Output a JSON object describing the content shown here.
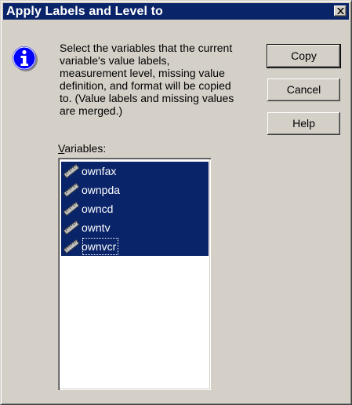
{
  "window": {
    "title": "Apply Labels and Level to"
  },
  "icons": {
    "info": "info-icon",
    "close": "close-icon",
    "variable": "ruler-icon"
  },
  "message": "Select the variables that the current\nvariable's value labels,\nmeasurement level, missing value\ndefinition, and format will be copied\nto.  (Value labels and missing values\nare merged.)",
  "buttons": {
    "copy": "Copy",
    "cancel": "Cancel",
    "help": "Help"
  },
  "variables": {
    "label_accel": "V",
    "label_rest": "ariables:",
    "items": [
      {
        "name": "ownfax"
      },
      {
        "name": "ownpda"
      },
      {
        "name": "owncd"
      },
      {
        "name": "owntv"
      },
      {
        "name": "ownvcr"
      }
    ]
  },
  "colors": {
    "title_bar": "#0a246a",
    "selection": "#0a246a",
    "face": "#d4d0c8"
  }
}
